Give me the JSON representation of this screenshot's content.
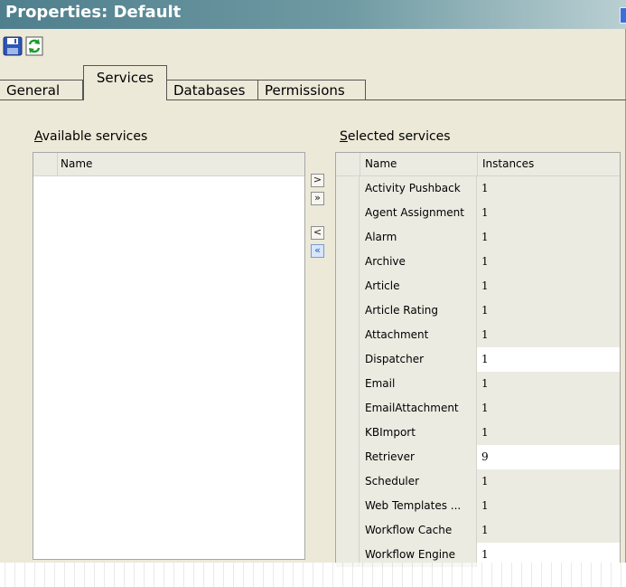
{
  "window": {
    "title": "Properties: Default"
  },
  "toolbar": {
    "save_icon": "floppy-disk-icon",
    "refresh_icon": "refresh-icon"
  },
  "tabs": [
    {
      "label": "General",
      "active": false
    },
    {
      "label": "Services",
      "active": true
    },
    {
      "label": "Databases",
      "active": false
    },
    {
      "label": "Permissions",
      "active": false
    }
  ],
  "available": {
    "label_underlined": "A",
    "label_rest": "vailable services",
    "column_name": "Name",
    "rows": []
  },
  "transfer_buttons": {
    "add": ">",
    "add_all": "»",
    "remove": "<",
    "remove_all": "«"
  },
  "selected": {
    "label_underlined": "S",
    "label_rest": "elected services",
    "column_name": "Name",
    "column_instances": "Instances",
    "rows": [
      {
        "name": "Activity Pushback",
        "instances": "1"
      },
      {
        "name": "Agent Assignment",
        "instances": "1"
      },
      {
        "name": "Alarm",
        "instances": "1"
      },
      {
        "name": "Archive",
        "instances": "1"
      },
      {
        "name": "Article",
        "instances": "1"
      },
      {
        "name": "Article Rating",
        "instances": "1"
      },
      {
        "name": "Attachment",
        "instances": "1"
      },
      {
        "name": "Dispatcher",
        "instances": "1"
      },
      {
        "name": "Email",
        "instances": "1"
      },
      {
        "name": "EmailAttachment",
        "instances": "1"
      },
      {
        "name": "KBImport",
        "instances": "1"
      },
      {
        "name": "Retriever",
        "instances": "9"
      },
      {
        "name": "Scheduler",
        "instances": "1"
      },
      {
        "name": "Web Templates ...",
        "instances": "1"
      },
      {
        "name": "Workflow Cache",
        "instances": "1"
      },
      {
        "name": "Workflow Engine",
        "instances": "1"
      }
    ]
  },
  "colors": {
    "title_start": "#4f7f8d",
    "panel_bg": "#ece9d8"
  }
}
